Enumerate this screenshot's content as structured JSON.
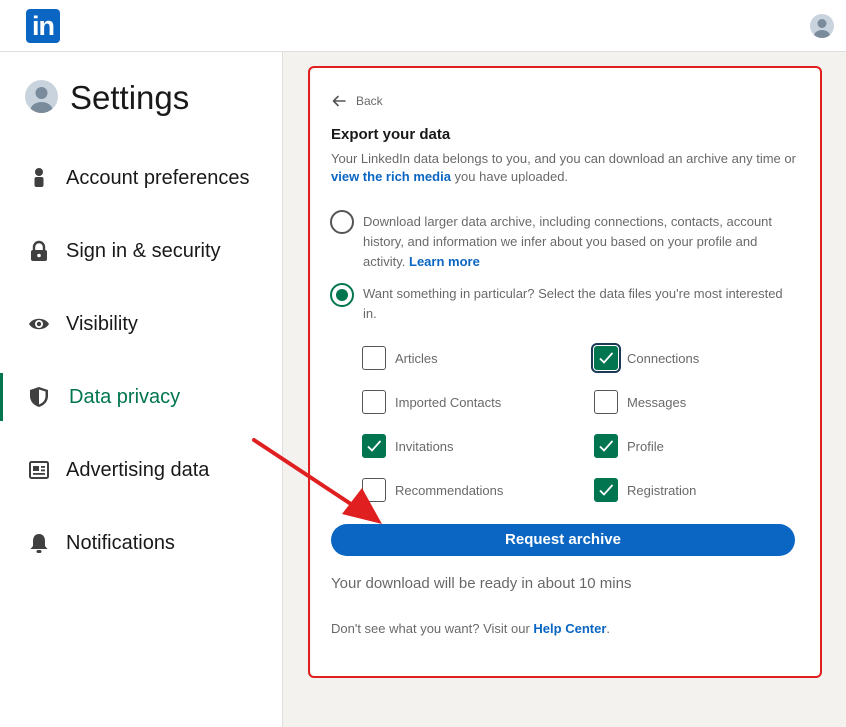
{
  "header": {
    "logo_text": "in",
    "logo_icon": "linkedin-logo",
    "profile_icon": "avatar-icon"
  },
  "sidebar": {
    "title": "Settings",
    "items": [
      {
        "label": "Account preferences",
        "icon": "person-icon",
        "active": false
      },
      {
        "label": "Sign in & security",
        "icon": "lock-icon",
        "active": false
      },
      {
        "label": "Visibility",
        "icon": "eye-icon",
        "active": false
      },
      {
        "label": "Data privacy",
        "icon": "shield-icon",
        "active": true
      },
      {
        "label": "Advertising data",
        "icon": "newspaper-icon",
        "active": false
      },
      {
        "label": "Notifications",
        "icon": "bell-icon",
        "active": false
      }
    ]
  },
  "main": {
    "back_label": "Back",
    "title": "Export your data",
    "description_pre": "Your LinkedIn data belongs to you, and you can download an archive any time or ",
    "description_link": "view the rich media",
    "description_post": " you have uploaded.",
    "option_full": {
      "text": "Download larger data archive, including connections, contacts, account history, and information we infer about you based on your profile and activity.",
      "link": "Learn more",
      "selected": false
    },
    "option_particular": {
      "text": "Want something in particular? Select the data files you're most interested in.",
      "selected": true
    },
    "files": [
      {
        "label": "Articles",
        "checked": false
      },
      {
        "label": "Connections",
        "checked": true
      },
      {
        "label": "Imported Contacts",
        "checked": false
      },
      {
        "label": "Messages",
        "checked": false
      },
      {
        "label": "Invitations",
        "checked": true
      },
      {
        "label": "Profile",
        "checked": true
      },
      {
        "label": "Recommendations",
        "checked": false
      },
      {
        "label": "Registration",
        "checked": true
      }
    ],
    "request_button": "Request archive",
    "ready_text": "Your download will be ready in about 10 mins",
    "help_pre": "Don't see what you want? Visit our ",
    "help_link": "Help Center",
    "help_post": "."
  },
  "colors": {
    "brand": "#0a66c2",
    "active_green": "#01754f",
    "annotation_red": "#e02020"
  }
}
